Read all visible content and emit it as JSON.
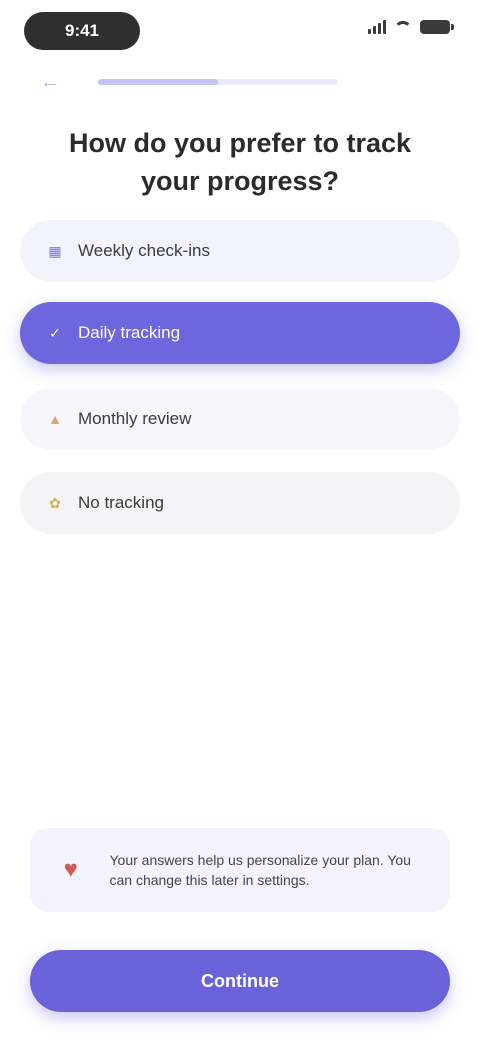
{
  "status_bar": {
    "time": "9:41"
  },
  "progress": {
    "value": 0.5
  },
  "question": {
    "text": "How do you prefer to track your progress?"
  },
  "options": [
    {
      "label": "Weekly check-ins",
      "icon": "calendar-icon",
      "selected": false
    },
    {
      "label": "Daily tracking",
      "icon": "check-icon",
      "selected": true
    },
    {
      "label": "Monthly review",
      "icon": "chart-icon",
      "selected": false
    },
    {
      "label": "No tracking",
      "icon": "leaf-icon",
      "selected": false
    }
  ],
  "note": {
    "text": "Your answers help us personalize your plan. You can change this later in settings.",
    "icon": "heart-icon"
  },
  "cta": {
    "label": "Continue"
  },
  "colors": {
    "accent": "#6e66dd",
    "accent_light": "#f3f3fd",
    "note_icon": "#d35a5a"
  }
}
